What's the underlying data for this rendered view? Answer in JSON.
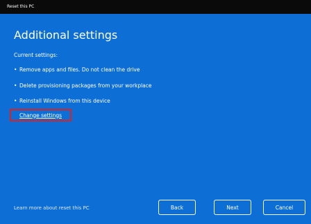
{
  "window": {
    "title": "Reset this PC"
  },
  "page": {
    "heading": "Additional settings",
    "current_settings_label": "Current settings:",
    "bullets": [
      "Remove apps and files. Do not clean the drive",
      "Delete provisioning packages from your workplace",
      "Reinstall Windows from this device"
    ],
    "bullet_glyph": "•",
    "change_settings_link": "Change settings",
    "learn_more_link": "Learn more about reset this PC"
  },
  "buttons": {
    "back": "Back",
    "next": "Next",
    "cancel": "Cancel"
  },
  "colors": {
    "panel_background": "#0d6fd6",
    "titlebar_background": "#0a0a0a",
    "highlight_border": "#e0201c"
  }
}
